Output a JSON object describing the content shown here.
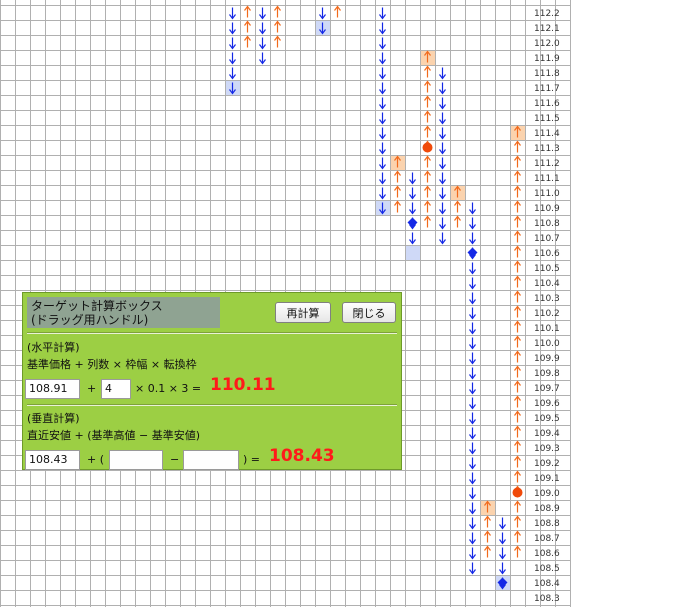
{
  "chart": {
    "price_axis": [
      "112.2",
      "112.1",
      "112.0",
      "111.9",
      "111.8",
      "111.7",
      "111.6",
      "111.5",
      "111.4",
      "111.3",
      "111.2",
      "111.1",
      "111.0",
      "110.9",
      "110.8",
      "110.7",
      "110.6",
      "110.5",
      "110.4",
      "110.3",
      "110.2",
      "110.1",
      "110.0",
      "109.9",
      "109.8",
      "109.7",
      "109.6",
      "109.5",
      "109.4",
      "109.3",
      "109.2",
      "109.1",
      "109.0",
      "108.9",
      "108.8",
      "108.7",
      "108.6",
      "108.5",
      "108.4",
      "108.3"
    ],
    "colors": {
      "up": "#f26a1b",
      "down": "#1428e6",
      "marker_red": "#f04a0a",
      "marker_blue": "#1428e6",
      "highlight_up": "#fbd3ae",
      "highlight_down": "#cfd9f7"
    }
  },
  "calc_box": {
    "title_line1": "ターゲット計算ボックス",
    "title_line2": "(ドラッグ用ハンドル)",
    "recalc_button": "再計算",
    "close_button": "閉じる",
    "horizontal": {
      "heading": "(水平計算)",
      "formula": "基準価格 + 列数 × 枠幅 × 転換枠",
      "base_price": "108.91",
      "plus": "+",
      "columns": "4",
      "times_box": "× 0.1 × 3 =",
      "result": "110.11"
    },
    "vertical": {
      "heading": "(垂直計算)",
      "formula": "直近安値 + (基準高値 − 基準安値)",
      "recent_low": "108.43",
      "plus_paren": "+ (",
      "base_high": "",
      "minus": "−",
      "base_low": "",
      "close_eq": ") =",
      "result": "108.43"
    }
  }
}
